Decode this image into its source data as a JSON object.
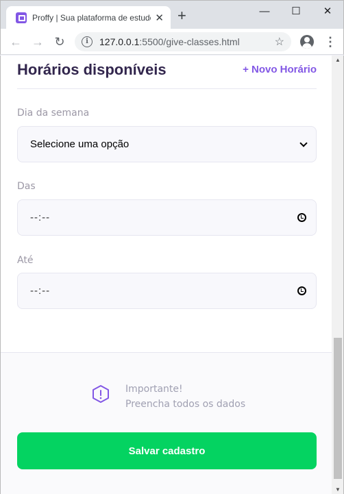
{
  "browser": {
    "tab_title": "Proffy | Sua plataforma de estudos",
    "tab_close": "✕",
    "new_tab": "+",
    "url_host": "127.0.0.1",
    "url_rest": ":5500/give-classes.html",
    "minimize": "—",
    "maximize": "☐",
    "close": "✕"
  },
  "section": {
    "title": "Horários disponíveis",
    "new_slot": "+ Novo Horário"
  },
  "fields": {
    "weekday_label": "Dia da semana",
    "weekday_value": "Selecione uma opção",
    "from_label": "Das",
    "from_value": "--:--",
    "to_label": "Até",
    "to_value": "--:--"
  },
  "footer": {
    "warning_title": "Importante!",
    "warning_text": "Preencha todos os dados",
    "save_label": "Salvar cadastro"
  },
  "colors": {
    "primary": "#8257e5",
    "title": "#32264d",
    "save": "#04d361"
  }
}
